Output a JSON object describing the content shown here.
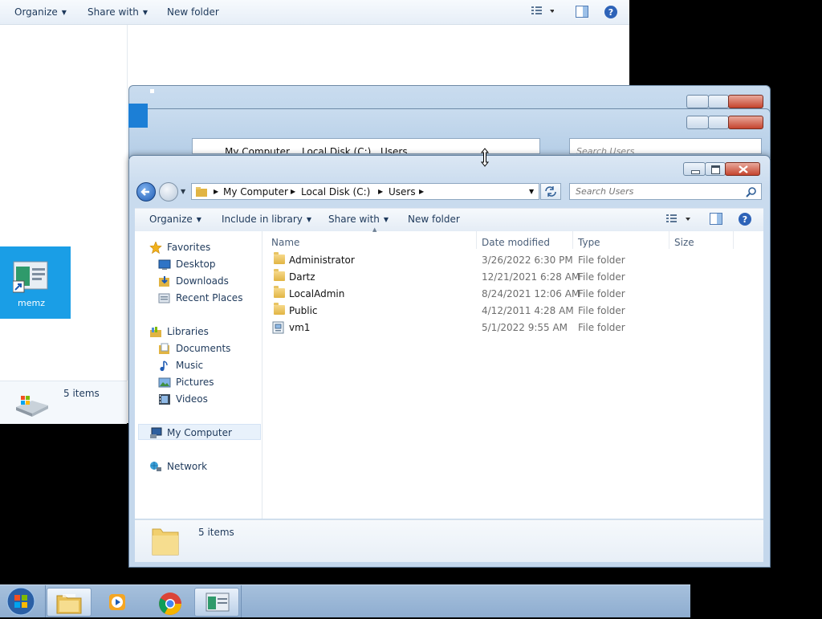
{
  "background_window": {
    "toolbar": {
      "organize": "Organize",
      "share_with": "Share with",
      "new_folder": "New folder"
    },
    "status": {
      "count": "5 items"
    }
  },
  "desktop": {
    "icon_label": "memz"
  },
  "window": {
    "address": {
      "crumbs": [
        "My Computer",
        "Local Disk (C:)",
        "Users"
      ]
    },
    "search": {
      "placeholder": "Search Users"
    },
    "toolbar": {
      "organize": "Organize",
      "include_in_library": "Include in library",
      "share_with": "Share with",
      "new_folder": "New folder"
    },
    "nav": {
      "favorites": "Favorites",
      "desktop": "Desktop",
      "downloads": "Downloads",
      "recent_places": "Recent Places",
      "libraries": "Libraries",
      "documents": "Documents",
      "music": "Music",
      "pictures": "Pictures",
      "videos": "Videos",
      "computer": "My Computer",
      "network": "Network"
    },
    "columns": {
      "name": "Name",
      "date": "Date modified",
      "type": "Type",
      "size": "Size"
    },
    "files": [
      {
        "name": "Administrator",
        "date": "3/26/2022 6:30 PM",
        "type": "File folder"
      },
      {
        "name": "Dartz",
        "date": "12/21/2021 6:28 AM",
        "type": "File folder"
      },
      {
        "name": "LocalAdmin",
        "date": "8/24/2021 12:06 AM",
        "type": "File folder"
      },
      {
        "name": "Public",
        "date": "4/12/2011 4:28 AM",
        "type": "File folder"
      },
      {
        "name": "vm1",
        "date": "5/1/2022 9:55 AM",
        "type": "File folder"
      }
    ],
    "status": {
      "count": "5 items"
    }
  },
  "ghost": {
    "crumbs": [
      "My Computer",
      "Local Disk (C:)",
      "Users"
    ],
    "search_placeholder": "Search Users"
  },
  "colors": {
    "accent": "#1a9ee6",
    "selection": "#e8f1fb",
    "back_button": "#2f6fc4"
  }
}
